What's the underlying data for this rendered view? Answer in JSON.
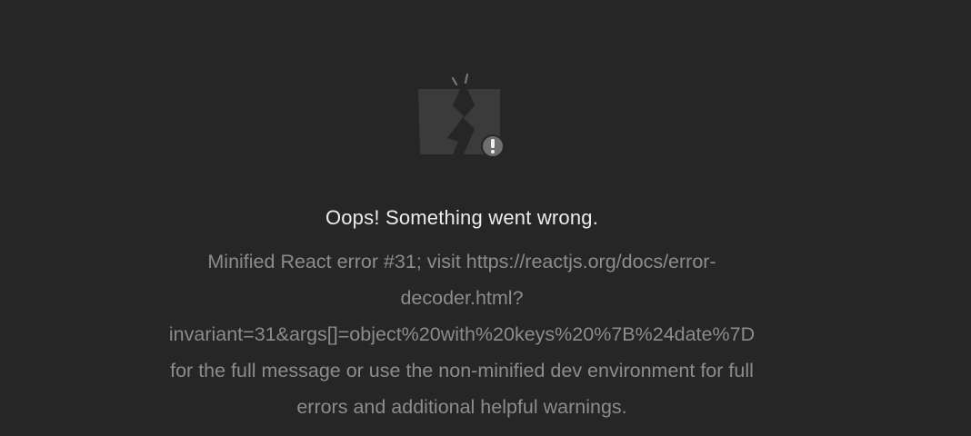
{
  "error": {
    "icon": "broken-page-warning-icon",
    "title": "Oops! Something went wrong.",
    "message_lines": [
      "Minified React error #31; visit https://reactjs.org/docs/error-",
      "decoder.html?",
      "invariant=31&args[]=object%20with%20keys%20%7B%24date%7D",
      "for the full message or use the non-minified dev environment for full",
      "errors and additional helpful warnings."
    ]
  },
  "colors": {
    "background": "#262626",
    "title": "#ececec",
    "message": "#8c8c8c",
    "icon_fill": "#3a3a3a",
    "badge": "#6e6e6e"
  }
}
